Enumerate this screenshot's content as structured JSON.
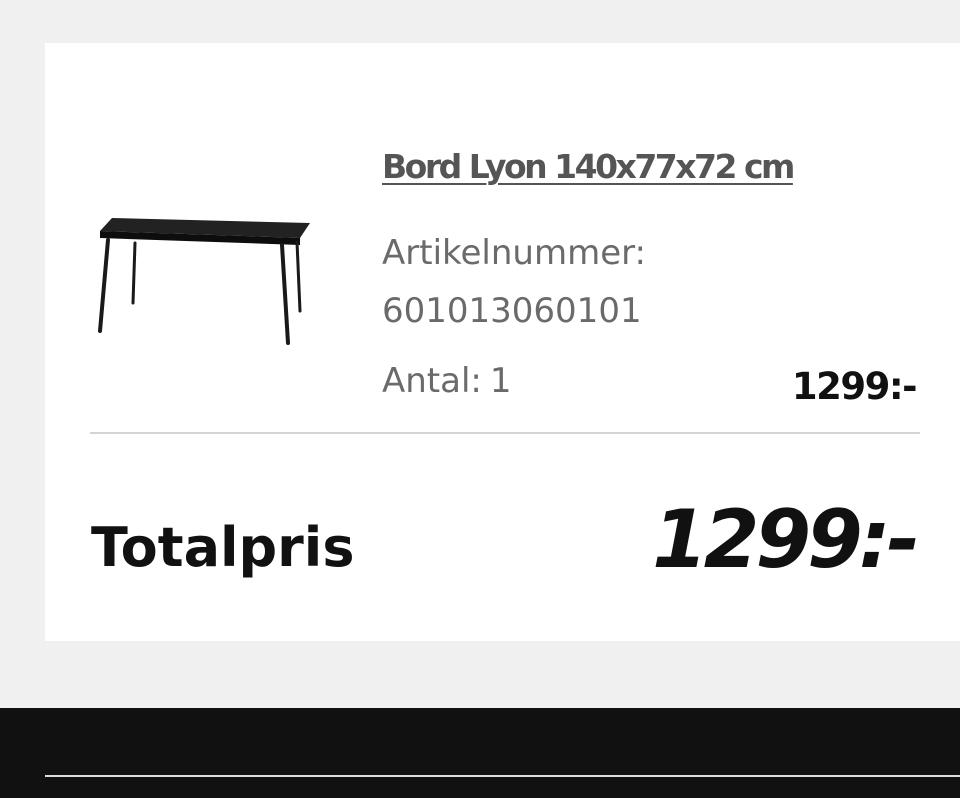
{
  "cart_item": {
    "title": "Bord Lyon 140x77x72 cm",
    "article_label": "Artikelnummer:",
    "article_number": "601013060101",
    "quantity_label": "Antal:",
    "quantity_value": "1",
    "price": "1299:-",
    "image_icon": "dining-table-icon"
  },
  "summary": {
    "total_label": "Totalpris",
    "total_price": "1299:-"
  },
  "colors": {
    "background": "#f0f0f0",
    "card": "#ffffff",
    "footer": "#111111",
    "muted_text": "#6a6a6a",
    "strong_text": "#111111",
    "divider": "#d4d4d4"
  }
}
